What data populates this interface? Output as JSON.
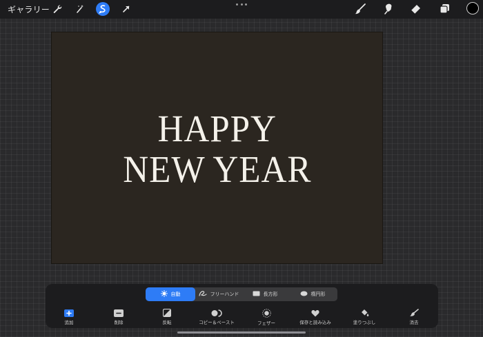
{
  "topbar": {
    "gallery_label": "ギャラリー",
    "left_tools": [
      {
        "icon": "wrench-icon",
        "active": false
      },
      {
        "icon": "magic-wand-icon",
        "active": false
      },
      {
        "icon": "selection-icon",
        "active": true
      },
      {
        "icon": "transform-arrow-icon",
        "active": false
      }
    ],
    "right_tools": [
      "brush-icon",
      "smudge-icon",
      "eraser-icon",
      "layers-icon"
    ],
    "current_color": "#000000",
    "accent_color": "#2e7cf6"
  },
  "canvas": {
    "background_color": "#2b2620",
    "text_color": "#f4f1ea",
    "line1": "HAPPY",
    "line2": "NEW YEAR"
  },
  "selection": {
    "modes": [
      {
        "label": "自動",
        "icon": "auto-selection-icon",
        "active": true
      },
      {
        "label": "フリーハンド",
        "icon": "freehand-icon",
        "active": false
      },
      {
        "label": "長方形",
        "icon": "rectangle-icon",
        "active": false
      },
      {
        "label": "楕円形",
        "icon": "ellipse-icon",
        "active": false
      }
    ],
    "actions": [
      {
        "label": "追加",
        "icon": "add-icon"
      },
      {
        "label": "削除",
        "icon": "remove-icon"
      },
      {
        "label": "反転",
        "icon": "invert-icon"
      },
      {
        "label": "コピー＆ペースト",
        "icon": "copy-paste-icon"
      },
      {
        "label": "フェザー",
        "icon": "feather-icon"
      },
      {
        "label": "保存と読み込み",
        "icon": "heart-icon"
      },
      {
        "label": "塗りつぶし",
        "icon": "fill-icon"
      },
      {
        "label": "消去",
        "icon": "clear-icon"
      }
    ]
  }
}
